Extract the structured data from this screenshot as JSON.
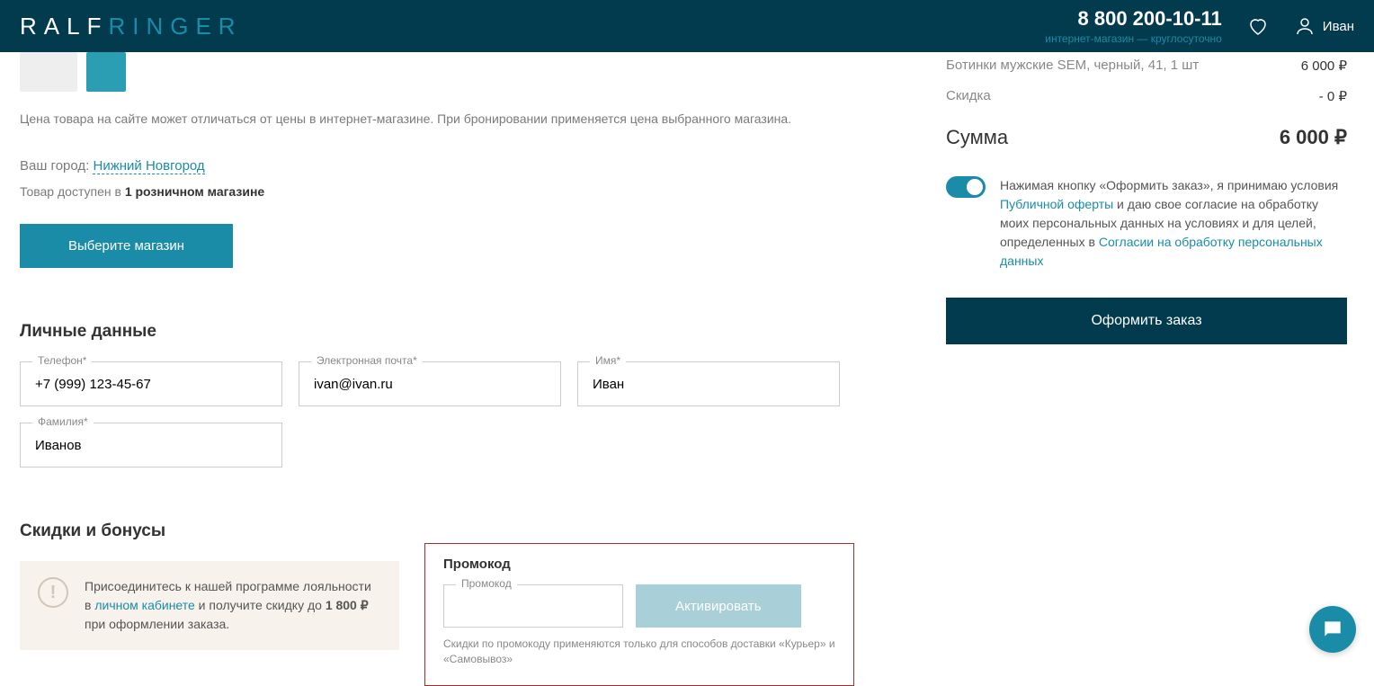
{
  "header": {
    "logo_first": "RALF",
    "logo_rest": "RINGER",
    "phone": "8 800 200-10-11",
    "phone_sub": "интернет-магазин — круглосуточно",
    "user_name": "Иван"
  },
  "left": {
    "price_note": "Цена товара на сайте может отличаться от цены в интернет-магазине. При бронировании применяется цена выбранного магазина.",
    "city_label": "Ваш город: ",
    "city": "Нижний Новгород",
    "avail_prefix": "Товар доступен в ",
    "avail_bold": "1 розничном магазине",
    "select_store_btn": "Выберите магазин",
    "personal_title": "Личные данные",
    "fields": {
      "phone_label": "Телефон*",
      "phone_value": "+7 (999) 123-45-67",
      "email_label": "Электронная почта*",
      "email_value": "ivan@ivan.ru",
      "fname_label": "Имя*",
      "fname_value": "Иван",
      "lname_label": "Фамилия*",
      "lname_value": "Иванов"
    },
    "bonus_title": "Скидки и бонусы",
    "loyalty": {
      "t1": "Присоединитесь к нашей программе лояльности в ",
      "t2": "личном кабинете",
      "t3": " и получите скидку до ",
      "t4": "1 800 ₽",
      "t5": " при оформлении заказа."
    },
    "promo": {
      "title": "Промокод",
      "field_label": "Промокод",
      "btn": "Активировать",
      "note": "Скидки по промокоду применяются только для способов доставки «Курьер» и «Самовывоз»"
    }
  },
  "right": {
    "item_name": "Ботинки мужские SEM, черный, 41, 1 шт",
    "item_price": "6 000",
    "discount_label": "Скидка",
    "discount_value": "- 0",
    "total_label": "Сумма",
    "total_value": "6 000",
    "consent": {
      "t1": "Нажимая кнопку «Оформить заказ», я принимаю условия ",
      "t2": "Публичной оферты",
      "t3": " и даю свое согласие на обработку моих персональных данных на условиях и для целей, определенных в ",
      "t4": "Согласии на обработку персональных данных"
    },
    "order_btn": "Оформить заказ"
  }
}
